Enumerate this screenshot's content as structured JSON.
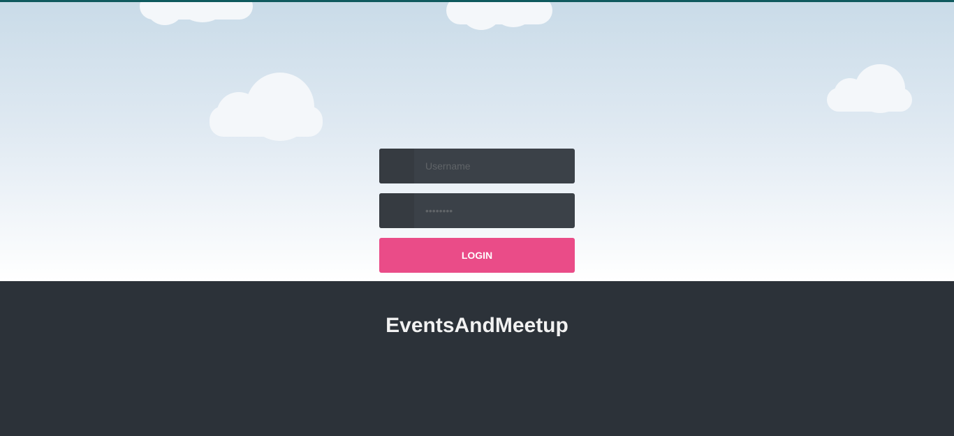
{
  "form": {
    "username_placeholder": "Username",
    "password_placeholder": "••••••••",
    "login_label": "LOGIN"
  },
  "footer": {
    "brand": "EventsAndMeetup"
  },
  "icons": {
    "username_icon": "user-icon",
    "password_icon": "lock-icon"
  },
  "colors": {
    "top_border": "#0f5a5e",
    "sky_top": "#c9dbe8",
    "sky_bottom": "#ffffff",
    "field_bg": "#3b4148",
    "icon_box_bg": "#363b41",
    "button_bg": "#ea4c88",
    "footer_bg": "#2c3239",
    "brand_text": "#f2f2f2"
  }
}
